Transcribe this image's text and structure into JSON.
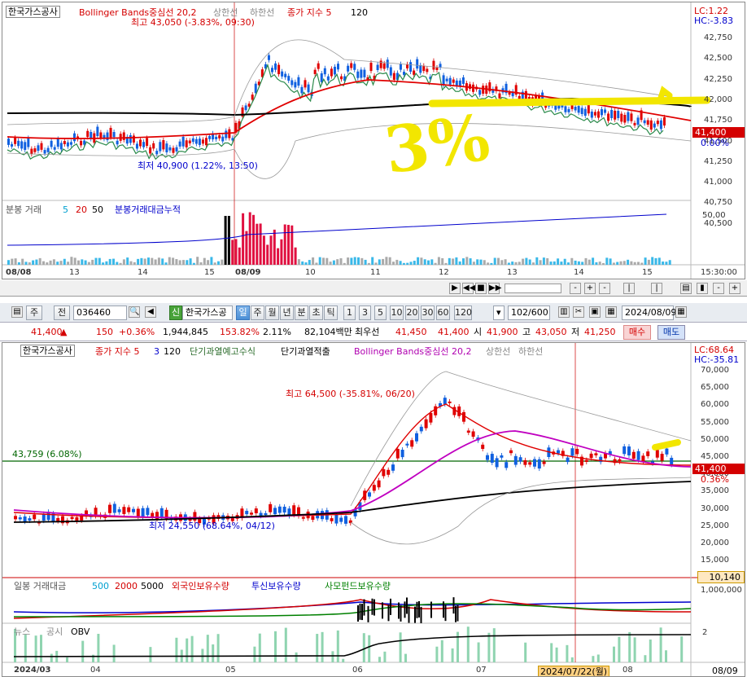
{
  "top_chart": {
    "stock_label": "한국가스공사",
    "indicator_bb": "Bollinger Bands중심선 20,2",
    "indicator_bb_upper": "상한선",
    "indicator_bb_lower": "하한선",
    "indicator_ma": "종가 지수 5",
    "indicator_ma2": "120",
    "lc": "LC:1.22",
    "hc": "HC:-3.83",
    "high_note": "최고 43,050 (-3.83%, 09:30)",
    "low_note": "최저 40,900 (1.22%, 13:50)",
    "price_axis": [
      "42,750",
      "42,500",
      "42,250",
      "42,000",
      "41,750",
      "41,500",
      "41,250",
      "41,000",
      "40,750",
      "40,500"
    ],
    "current_price": "41,400",
    "current_change": "0.00%",
    "handwriting": "3%",
    "volume_legend": {
      "label": "분봉 거래",
      "n1": "5",
      "n2": "20",
      "n3": "50",
      "cum": "분봉거래대금누적"
    },
    "volume_axis": "50,00",
    "time_axis": [
      "08/08",
      "13",
      "14",
      "15",
      "08/09",
      "10",
      "11",
      "12",
      "13",
      "14",
      "15",
      "15:30:00"
    ]
  },
  "toolbar": {
    "tab_week": "주",
    "tab_prev": "전",
    "code": "036460",
    "shin_badge": "신",
    "stock_name": "한국가스공",
    "periods": [
      "일",
      "주",
      "월",
      "년",
      "분",
      "초",
      "틱"
    ],
    "active_period": "일",
    "counts": [
      "1",
      "3",
      "5",
      "10",
      "20",
      "30",
      "60",
      "120"
    ],
    "range": "102/600",
    "date": "2024/08/09"
  },
  "quote_bar": {
    "price": "41,400",
    "arrow": "▲",
    "change": "150",
    "change_pct": "+0.36%",
    "volume": "1,944,845",
    "vol_ratio": "153.82%",
    "turnover": "2.11%",
    "amount": "82,104백만",
    "best_ask_label": "최우선",
    "best_ask": "41,450",
    "best_bid": "41,400",
    "open_label": "시",
    "open": "41,900",
    "high_label": "고",
    "high": "43,050",
    "low_label": "저",
    "low": "41,250",
    "buy_button": "매수",
    "sell_button": "매도"
  },
  "bottom_chart": {
    "stock_label": "한국가스공사",
    "legend_ma": "종가 지수 5",
    "legend_ma_n2": "3",
    "legend_ma_n3": "120",
    "legend_overheat": "단기과열예고수식",
    "legend_overheat2": "단기과열적출",
    "legend_bb": "Bollinger Bands중심선 20,2",
    "legend_bb_upper": "상한선",
    "legend_bb_lower": "하한선",
    "lc": "LC:68.64",
    "hc": "HC:-35.81",
    "price_axis": [
      "70,000",
      "65,000",
      "60,000",
      "55,000",
      "50,000",
      "45,000",
      "40,000",
      "35,000",
      "30,000",
      "25,000",
      "20,000",
      "15,000"
    ],
    "current_price": "41,400",
    "current_change": "0.36%",
    "level_line_label": "43,759 (6.08%)",
    "high_note": "최고 64,500 (-35.81%, 06/20)",
    "low_note": "최저 24,550 (68.64%, 04/12)",
    "volume_legend": {
      "label": "일봉 거래대금",
      "n1": "500",
      "n2": "2000",
      "n3": "5000",
      "foreign": "외국인보유수량",
      "trust": "투신보유수량",
      "fund": "사모펀드보유수량"
    },
    "volume_axis_top": "10,140",
    "volume_axis_sub": "1,000,000",
    "news_legend": {
      "news": "뉴스",
      "notice": "공시",
      "obv": "OBV"
    },
    "obv_axis": "2",
    "time_axis": [
      "2024/03",
      "04",
      "05",
      "06",
      "07",
      "08"
    ],
    "cursor_date": "2024/07/22(월)",
    "right_date": "08/09"
  }
}
